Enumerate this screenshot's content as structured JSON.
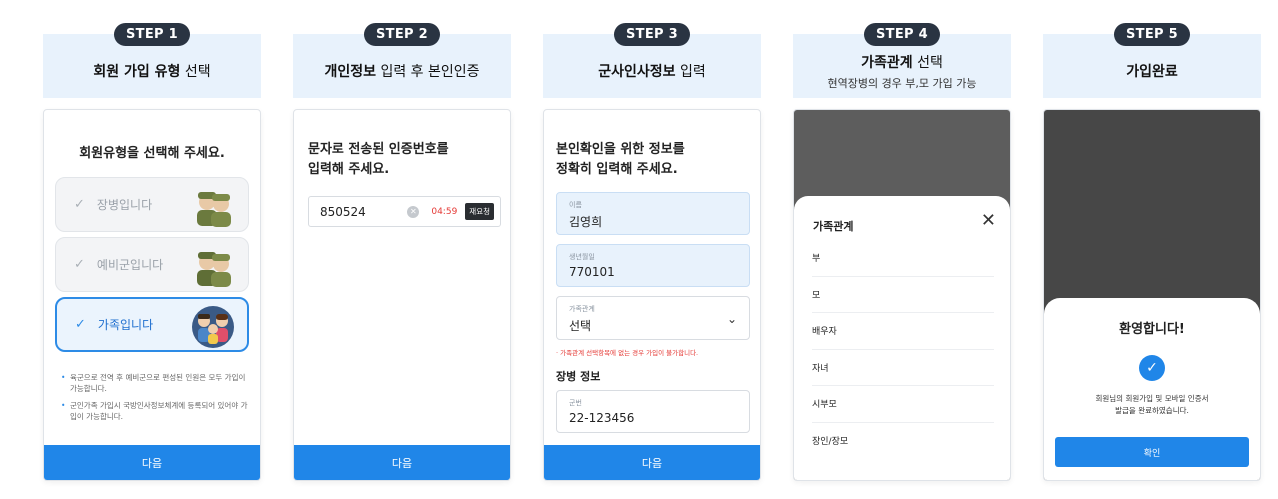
{
  "steps": [
    {
      "badge": "STEP 1",
      "title_bold": "회원 가입 유형",
      "title_rest": " 선택",
      "screen": {
        "heading": "회원유형을 선택해 주세요.",
        "options": [
          {
            "label": "장병입니다",
            "selected": false
          },
          {
            "label": "예비군입니다",
            "selected": false
          },
          {
            "label": "가족입니다",
            "selected": true
          }
        ],
        "notes": [
          "육군으로 전역 후 예비군으로 편성된 인원은 모두 가입이 가능합니다.",
          "군인가족 가입시 국방인사정보체계에 등록되어 있어야 가입이 가능합니다."
        ],
        "next_label": "다음"
      }
    },
    {
      "badge": "STEP 2",
      "title_bold": "개인정보",
      "title_rest": " 입력 후 본인인증",
      "screen": {
        "heading_line1": "문자로 전송된 인증번호를",
        "heading_line2": "입력해 주세요.",
        "code_value": "850524",
        "timer": "04:59",
        "resend_label": "재요청",
        "next_label": "다음"
      }
    },
    {
      "badge": "STEP 3",
      "title_bold": "군사인사정보",
      "title_rest": " 입력",
      "screen": {
        "heading_line1": "본인확인을 위한 정보를",
        "heading_line2": "정확히 입력해 주세요.",
        "name_label": "이름",
        "name_value": "김영희",
        "birth_label": "생년월일",
        "birth_value": "770101",
        "relation_label": "가족관계",
        "relation_value": "선택",
        "warning": "가족관계 선택항목에 없는 경우 가입이 불가합니다.",
        "section_title": "장병 정보",
        "service_label": "군번",
        "service_value": "22-123456",
        "next_label": "다음"
      }
    },
    {
      "badge": "STEP 4",
      "title_bold": "가족관계",
      "title_rest": " 선택",
      "subtitle": "현역장병의 경우 부,모 가입 가능",
      "screen": {
        "sheet_title": "가족관계",
        "items": [
          "부",
          "모",
          "배우자",
          "자녀",
          "시부모",
          "장인/장모"
        ]
      }
    },
    {
      "badge": "STEP 5",
      "title_bold": "가입완료",
      "title_rest": "",
      "screen": {
        "modal_title": "환영합니다!",
        "message_line1": "회원님의 회원가입 및 모바일 인증서",
        "message_line2": "발급을 완료하였습니다.",
        "confirm_label": "확인"
      }
    }
  ],
  "colors": {
    "accent": "#2086e8",
    "badge_bg": "#2a3442",
    "header_bg": "#e8f2fc",
    "warning": "#e53935"
  }
}
